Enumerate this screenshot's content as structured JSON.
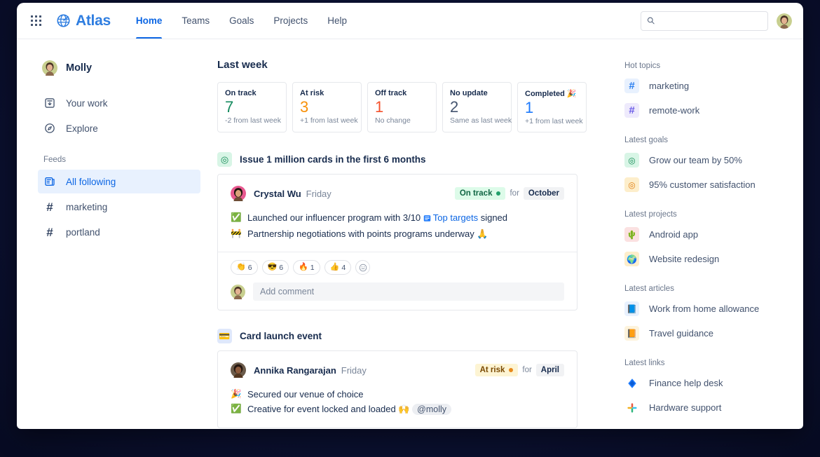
{
  "nav": {
    "app_switcher": "app-switcher",
    "brand": "Atlas",
    "links": [
      {
        "label": "Home",
        "active": true
      },
      {
        "label": "Teams",
        "active": false
      },
      {
        "label": "Goals",
        "active": false
      },
      {
        "label": "Projects",
        "active": false
      },
      {
        "label": "Help",
        "active": false
      }
    ],
    "search_placeholder": "",
    "search_value": ""
  },
  "sidebar": {
    "user": "Molly",
    "items": [
      {
        "label": "Your work",
        "icon": "your-work-icon"
      },
      {
        "label": "Explore",
        "icon": "explore-compass-icon"
      }
    ],
    "feeds_label": "Feeds",
    "feeds": [
      {
        "label": "All following",
        "icon": "feed-icon",
        "selected": true
      },
      {
        "label": "marketing",
        "icon": "hash-icon",
        "selected": false
      },
      {
        "label": "portland",
        "icon": "hash-icon",
        "selected": false
      }
    ]
  },
  "main": {
    "heading": "Last week",
    "stats": [
      {
        "title": "On track",
        "value": "7",
        "color": "#138a5e",
        "sub": "-2 from last week"
      },
      {
        "title": "At risk",
        "value": "3",
        "color": "#f79008",
        "sub": "+1 from last week"
      },
      {
        "title": "Off track",
        "value": "1",
        "color": "#f4512c",
        "sub": "No change"
      },
      {
        "title": "No update",
        "value": "2",
        "color": "#44546f",
        "sub": "Same as last week"
      },
      {
        "title": "Completed 🎉",
        "value": "1",
        "color": "#1d7afc",
        "sub": "+1 from last week"
      }
    ],
    "posts": [
      {
        "goal_emoji": "◎",
        "goal_emoji_bg": "#d8f5e6",
        "goal_emoji_color": "#108a53",
        "goal_title": "Issue 1 million cards in the first 6 months",
        "author": "Crystal Wu",
        "when": "Friday",
        "status": "On track",
        "status_bg": "#ddfbe9",
        "status_color": "#116644",
        "status_dot": "#22a06b",
        "for_label": "for",
        "period": "October",
        "bullets": [
          {
            "icon": "✅",
            "pre": "Launched our influencer program with 3/10 ",
            "link": "Top targets",
            "post": " signed"
          },
          {
            "icon": "🚧",
            "pre": "Partnership negotiations with points programs underway 🙏",
            "link": "",
            "post": ""
          }
        ],
        "reactions": [
          {
            "emoji": "👏",
            "count": "6"
          },
          {
            "emoji": "😎",
            "count": "6"
          },
          {
            "emoji": "🔥",
            "count": "1"
          },
          {
            "emoji": "👍",
            "count": "4"
          }
        ],
        "add_reaction_icon": "add-reaction-icon",
        "comment_placeholder": "Add comment"
      },
      {
        "goal_emoji": "💳",
        "goal_emoji_bg": "#dfe8fb",
        "goal_emoji_color": "#172b4d",
        "goal_title": "Card launch event",
        "author": "Annika Rangarajan",
        "when": "Friday",
        "status": "At risk",
        "status_bg": "#fdf4d3",
        "status_color": "#7a4900",
        "status_dot": "#e8891a",
        "for_label": "for",
        "period": "April",
        "bullets": [
          {
            "icon": "🎉",
            "pre": "Secured our venue of choice",
            "link": "",
            "post": ""
          },
          {
            "icon": "✅",
            "pre": "Creative for event locked and loaded 🙌 ",
            "mention": "@molly",
            "link": "",
            "post": ""
          }
        ]
      }
    ]
  },
  "rightbar": {
    "groups": [
      {
        "title": "Hot topics",
        "items": [
          {
            "label": "marketing",
            "tile": "#",
            "tile_bg": "#e8f1fe",
            "tile_color": "#2a7ff0"
          },
          {
            "label": "remote-work",
            "tile": "#",
            "tile_bg": "#eeeafc",
            "tile_color": "#6b5ce7"
          }
        ]
      },
      {
        "title": "Latest goals",
        "items": [
          {
            "label": "Grow our team by 50%",
            "tile": "◎",
            "tile_bg": "#d8f5e6",
            "tile_color": "#108a53"
          },
          {
            "label": "95% customer satisfaction",
            "tile": "◎",
            "tile_bg": "#fdeecb",
            "tile_color": "#e07f12"
          }
        ]
      },
      {
        "title": "Latest projects",
        "items": [
          {
            "label": "Android app",
            "tile": "🌵",
            "tile_bg": "#fbe1e1",
            "tile_color": "#172b4d"
          },
          {
            "label": "Website redesign",
            "tile": "🌍",
            "tile_bg": "#fdeecb",
            "tile_color": "#172b4d"
          }
        ]
      },
      {
        "title": "Latest articles",
        "items": [
          {
            "label": "Work from home allowance",
            "tile": "📘",
            "tile_bg": "#e8f1fe",
            "tile_color": "#172b4d"
          },
          {
            "label": "Travel guidance",
            "tile": "📙",
            "tile_bg": "#fdf3dc",
            "tile_color": "#172b4d"
          }
        ]
      },
      {
        "title": "Latest links",
        "items": [
          {
            "label": "Finance help desk",
            "tile": "◆",
            "tile_bg": "#ffffff",
            "tile_color": "#1d7afc"
          },
          {
            "label": "Hardware support",
            "tile": "✜",
            "tile_bg": "#ffffff",
            "tile_color": "#e8573f"
          }
        ]
      }
    ]
  }
}
